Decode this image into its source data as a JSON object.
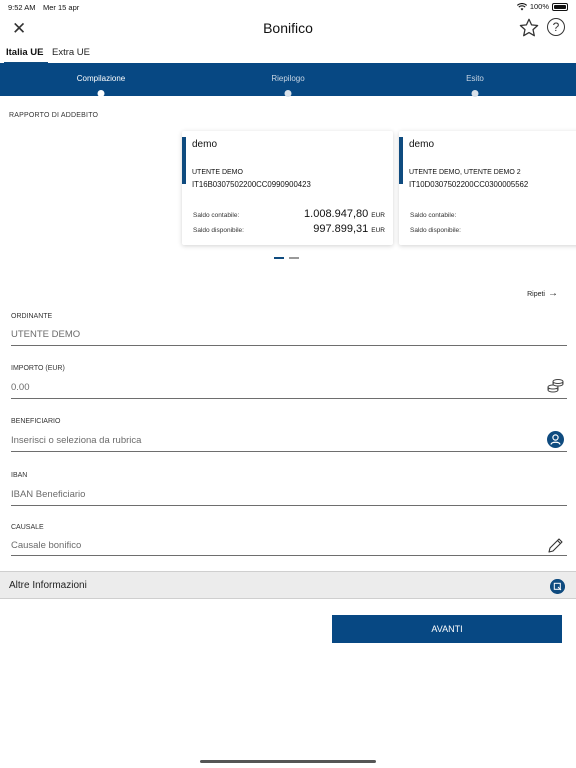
{
  "status": {
    "time": "9:52 AM",
    "date": "Mer 15 apr",
    "battery": "100%"
  },
  "header": {
    "title": "Bonifico",
    "close_icon": "close-icon",
    "star_icon": "star-icon",
    "help_icon": "help-icon"
  },
  "tabs": [
    {
      "label": "Italia UE",
      "active": true
    },
    {
      "label": "Extra UE",
      "active": false
    }
  ],
  "steps": [
    {
      "label": "Compilazione",
      "active": true
    },
    {
      "label": "Riepilogo",
      "active": false
    },
    {
      "label": "Esito",
      "active": false
    }
  ],
  "rapporto": {
    "label": "RAPPORTO DI ADDEBITO",
    "cards": [
      {
        "name": "demo",
        "holder": "UTENTE DEMO",
        "iban": "IT16B0307502200CC0990900423",
        "saldo_contabile_label": "Saldo contabile:",
        "saldo_contabile": "1.008.947,80",
        "saldo_disponibile_label": "Saldo disponibile:",
        "saldo_disponibile": "997.899,31",
        "currency": "EUR"
      },
      {
        "name": "demo",
        "holder": "UTENTE DEMO, UTENTE DEMO 2",
        "iban": "IT10D0307502200CC0300005562",
        "saldo_contabile_label": "Saldo contabile:",
        "saldo_disponibile_label": "Saldo disponibile:"
      }
    ],
    "page_count": 2,
    "current_page": 1
  },
  "repeat": {
    "label": "Ripeti"
  },
  "form": {
    "ordinante": {
      "label": "ORDINANTE",
      "value": "UTENTE DEMO"
    },
    "importo": {
      "label": "IMPORTO (EUR)",
      "value": "0.00",
      "icon": "coins-icon"
    },
    "beneficiario": {
      "label": "BENEFICIARIO",
      "placeholder": "Inserisci o seleziona da rubrica",
      "icon": "contact-icon"
    },
    "iban": {
      "label": "IBAN",
      "placeholder": "IBAN Beneficiario"
    },
    "causale": {
      "label": "CAUSALE",
      "placeholder": "Causale bonifico",
      "icon": "pencil-icon"
    }
  },
  "altre": {
    "label": "Altre Informazioni"
  },
  "submit": {
    "label": "AVANTI"
  },
  "colors": {
    "primary": "#074883",
    "accent": "#0f4b7f"
  }
}
